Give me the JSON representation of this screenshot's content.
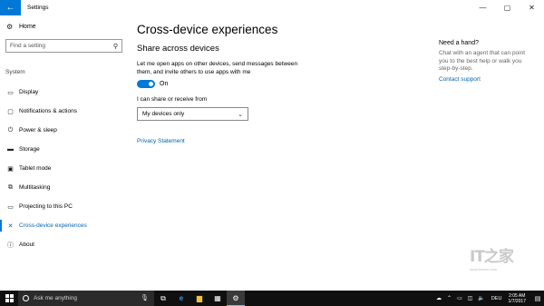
{
  "window": {
    "title": "Settings",
    "back_icon": "←",
    "minimize_icon": "—",
    "maximize_icon": "▢",
    "close_icon": "✕"
  },
  "nav": {
    "home_label": "Home",
    "search_placeholder": "Find a setting",
    "section_label": "System",
    "items": [
      {
        "label": "Display",
        "icon": "▭"
      },
      {
        "label": "Notifications & actions",
        "icon": "▢"
      },
      {
        "label": "Power & sleep",
        "icon": "⏻"
      },
      {
        "label": "Storage",
        "icon": "▬"
      },
      {
        "label": "Tablet mode",
        "icon": "▣"
      },
      {
        "label": "Multitasking",
        "icon": "⧉"
      },
      {
        "label": "Projecting to this PC",
        "icon": "▭"
      },
      {
        "label": "Cross-device experiences",
        "icon": "✕"
      },
      {
        "label": "About",
        "icon": "ⓘ"
      }
    ],
    "active_index": 7
  },
  "main": {
    "page_title": "Cross-device experiences",
    "section_title": "Share across devices",
    "description": "Let me open apps on other devices, send messages between them, and invite others to use apps with me",
    "toggle_state": "On",
    "share_label": "I can share or receive from",
    "share_value": "My devices only",
    "privacy_link": "Privacy Statement"
  },
  "help": {
    "title": "Need a hand?",
    "text": "Chat with an agent that can point you to the best help or walk you step-by-step.",
    "link": "Contact support"
  },
  "watermark": {
    "logo": "IT之家",
    "url": "www.ithome.com"
  },
  "taskbar": {
    "search_placeholder": "Ask me anything",
    "language": "DEU",
    "time": "2:05 AM",
    "date": "1/7/2017"
  },
  "colors": {
    "accent": "#0078d7",
    "link": "#0063b1",
    "taskbar": "#101010"
  }
}
